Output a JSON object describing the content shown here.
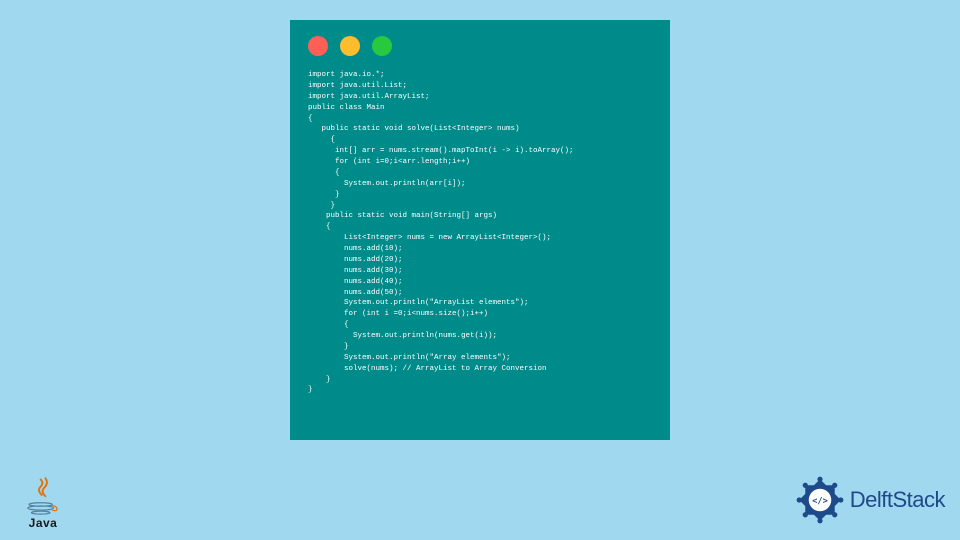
{
  "colors": {
    "background": "#a0d8ef",
    "windowBg": "#008B8B",
    "dotRed": "#ff5f56",
    "dotYellow": "#ffbd2e",
    "dotGreen": "#27c93f",
    "javaRed": "#e76f00",
    "javaBlue": "#5382a1",
    "delftBlue": "#1e4a8a"
  },
  "javaLogo": {
    "text": "Java"
  },
  "delftStack": {
    "text": "DelftStack"
  },
  "codeLines": [
    "import java.io.*;",
    "import java.util.List;",
    "import java.util.ArrayList;",
    "public class Main",
    "{",
    "   public static void solve(List<Integer> nums)",
    "     {",
    "      int[] arr = nums.stream().mapToInt(i -> i).toArray();",
    "      for (int i=0;i<arr.length;i++)",
    "      {",
    "        System.out.println(arr[i]);",
    "      }",
    "     }",
    "    public static void main(String[] args)",
    "    {",
    "        List<Integer> nums = new ArrayList<Integer>();",
    "        nums.add(10);",
    "        nums.add(20);",
    "        nums.add(30);",
    "        nums.add(40);",
    "        nums.add(50);",
    "        System.out.println(\"ArrayList elements\");",
    "        for (int i =0;i<nums.size();i++)",
    "        {",
    "          System.out.println(nums.get(i));",
    "        }",
    "        System.out.println(\"Array elements\");",
    "        solve(nums); // ArrayList to Array Conversion",
    "    }",
    "}"
  ]
}
